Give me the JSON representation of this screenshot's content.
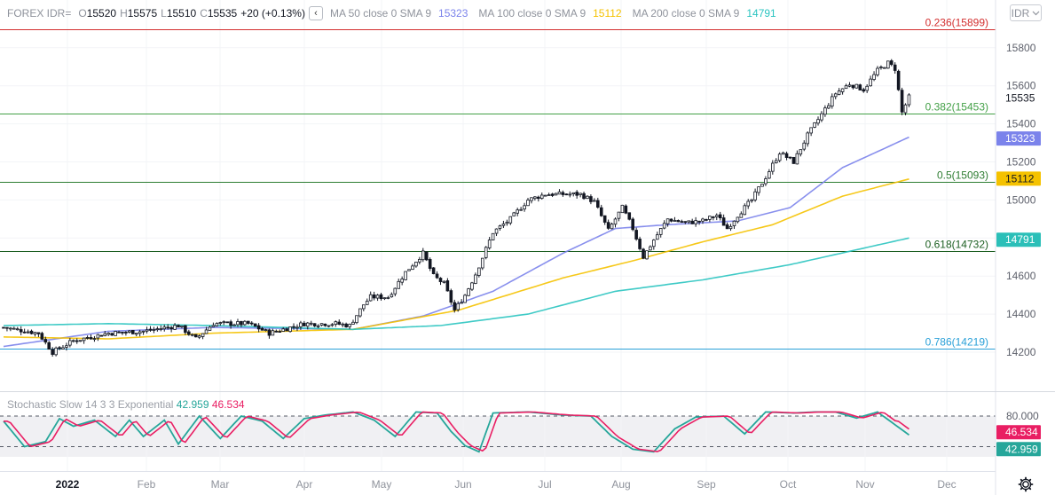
{
  "header": {
    "symbol": "FOREX IDR=",
    "o_label": "O",
    "o_value": "15520",
    "h_label": "H",
    "h_value": "15575",
    "l_label": "L",
    "l_value": "15510",
    "c_label": "C",
    "c_value": "15535",
    "change": "+20 (+0.13%)",
    "collapse_icon": "chevron-left-icon",
    "ma50_label": "MA 50 close 0 SMA 9",
    "ma50_value": "15323",
    "ma100_label": "MA 100 close 0 SMA 9",
    "ma100_value": "15112",
    "ma200_label": "MA 200 close 0 SMA 9",
    "ma200_value": "14791",
    "currency_button": "IDR",
    "currency_icon": "chevron-down-icon"
  },
  "stochastic": {
    "label": "Stochastic Slow 14 3 3 Exponential",
    "k_value": "42.959",
    "d_value": "46.534",
    "upper_band": "80.000",
    "k_color": "#26a69a",
    "d_color": "#e91e63"
  },
  "colors": {
    "ma50": "#7b83eb",
    "ma100": "#f5c200",
    "ma200": "#2ac4c0",
    "fib_0236": "#d32f2f",
    "fib_0382": "#43a047",
    "fib_05": "#2e7d32",
    "fib_0618": "#1b5e20",
    "fib_0786": "#29a0d8",
    "price_tag": "#ffffff"
  },
  "settings_icon": "gear-icon",
  "chart_data": {
    "type": "candlestick",
    "y_range": [
      14100,
      16000
    ],
    "y_ticks": [
      "15800",
      "15600",
      "15400",
      "15200",
      "15000",
      "14800",
      "14600",
      "14400",
      "14200"
    ],
    "x_ticks": [
      "2022",
      "Feb",
      "Mar",
      "Apr",
      "May",
      "Jun",
      "Jul",
      "Aug",
      "Sep",
      "Oct",
      "Nov",
      "Dec"
    ],
    "last_price_tag": "15535",
    "fib_levels": [
      {
        "label": "0.236(15899)",
        "value": 15899
      },
      {
        "label": "0.382(15453)",
        "value": 15453
      },
      {
        "label": "0.5(15093)",
        "value": 15093
      },
      {
        "label": "0.618(14732)",
        "value": 14732
      },
      {
        "label": "0.786(14219)",
        "value": 14219
      }
    ],
    "ma_tags": [
      {
        "name": "MA 50",
        "value": 15323,
        "label": "15323"
      },
      {
        "name": "MA 100",
        "value": 15112,
        "label": "15112"
      },
      {
        "name": "MA 200",
        "value": 14791,
        "label": "14791"
      }
    ],
    "close_anchors": [
      [
        0,
        14330
      ],
      [
        10,
        14300
      ],
      [
        14,
        14200
      ],
      [
        20,
        14260
      ],
      [
        30,
        14300
      ],
      [
        40,
        14310
      ],
      [
        50,
        14340
      ],
      [
        55,
        14270
      ],
      [
        60,
        14350
      ],
      [
        70,
        14350
      ],
      [
        76,
        14300
      ],
      [
        82,
        14330
      ],
      [
        86,
        14350
      ],
      [
        90,
        14350
      ],
      [
        95,
        14350
      ],
      [
        99,
        14340
      ],
      [
        103,
        14450
      ],
      [
        105,
        14490
      ],
      [
        107,
        14490
      ],
      [
        110,
        14490
      ],
      [
        115,
        14620
      ],
      [
        120,
        14720
      ],
      [
        123,
        14600
      ],
      [
        126,
        14560
      ],
      [
        129,
        14420
      ],
      [
        132,
        14500
      ],
      [
        135,
        14610
      ],
      [
        140,
        14830
      ],
      [
        145,
        14900
      ],
      [
        150,
        15000
      ],
      [
        155,
        15030
      ],
      [
        165,
        15030
      ],
      [
        169,
        14990
      ],
      [
        173,
        14840
      ],
      [
        177,
        14960
      ],
      [
        180,
        14850
      ],
      [
        183,
        14700
      ],
      [
        186,
        14790
      ],
      [
        190,
        14900
      ],
      [
        195,
        14880
      ],
      [
        200,
        14890
      ],
      [
        204,
        14920
      ],
      [
        207,
        14850
      ],
      [
        210,
        14920
      ],
      [
        214,
        15000
      ],
      [
        218,
        15120
      ],
      [
        222,
        15250
      ],
      [
        226,
        15200
      ],
      [
        230,
        15340
      ],
      [
        234,
        15450
      ],
      [
        238,
        15560
      ],
      [
        242,
        15610
      ],
      [
        246,
        15580
      ],
      [
        250,
        15680
      ],
      [
        253,
        15720
      ],
      [
        255,
        15690
      ],
      [
        257,
        15460
      ],
      [
        259,
        15540
      ]
    ],
    "ma_anchors": {
      "ma50": [
        [
          0,
          14230
        ],
        [
          30,
          14310
        ],
        [
          60,
          14330
        ],
        [
          100,
          14320
        ],
        [
          120,
          14390
        ],
        [
          140,
          14520
        ],
        [
          160,
          14720
        ],
        [
          175,
          14850
        ],
        [
          190,
          14870
        ],
        [
          210,
          14890
        ],
        [
          225,
          14960
        ],
        [
          240,
          15170
        ],
        [
          259,
          15330
        ]
      ],
      "ma100": [
        [
          0,
          14280
        ],
        [
          30,
          14270
        ],
        [
          60,
          14300
        ],
        [
          100,
          14320
        ],
        [
          130,
          14420
        ],
        [
          160,
          14590
        ],
        [
          180,
          14680
        ],
        [
          200,
          14780
        ],
        [
          220,
          14870
        ],
        [
          240,
          15020
        ],
        [
          259,
          15110
        ]
      ],
      "ma200": [
        [
          0,
          14340
        ],
        [
          30,
          14350
        ],
        [
          60,
          14340
        ],
        [
          100,
          14320
        ],
        [
          125,
          14340
        ],
        [
          150,
          14400
        ],
        [
          175,
          14520
        ],
        [
          200,
          14580
        ],
        [
          225,
          14660
        ],
        [
          259,
          14800
        ]
      ]
    },
    "stoch_anchors": [
      [
        0,
        70
      ],
      [
        6,
        20
      ],
      [
        12,
        30
      ],
      [
        16,
        75
      ],
      [
        20,
        60
      ],
      [
        26,
        72
      ],
      [
        32,
        40
      ],
      [
        36,
        72
      ],
      [
        40,
        40
      ],
      [
        46,
        72
      ],
      [
        50,
        25
      ],
      [
        56,
        80
      ],
      [
        62,
        36
      ],
      [
        68,
        80
      ],
      [
        74,
        70
      ],
      [
        80,
        36
      ],
      [
        86,
        75
      ],
      [
        92,
        82
      ],
      [
        100,
        88
      ],
      [
        106,
        72
      ],
      [
        112,
        40
      ],
      [
        118,
        88
      ],
      [
        124,
        86
      ],
      [
        128,
        50
      ],
      [
        132,
        22
      ],
      [
        136,
        10
      ],
      [
        140,
        86
      ],
      [
        150,
        88
      ],
      [
        160,
        82
      ],
      [
        168,
        80
      ],
      [
        174,
        40
      ],
      [
        180,
        15
      ],
      [
        186,
        10
      ],
      [
        192,
        55
      ],
      [
        198,
        78
      ],
      [
        206,
        80
      ],
      [
        212,
        45
      ],
      [
        218,
        88
      ],
      [
        226,
        86
      ],
      [
        232,
        88
      ],
      [
        238,
        88
      ],
      [
        244,
        76
      ],
      [
        250,
        88
      ],
      [
        256,
        58
      ],
      [
        259,
        43
      ]
    ]
  }
}
